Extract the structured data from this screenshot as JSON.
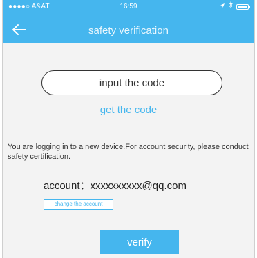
{
  "status_bar": {
    "carrier": "●●●●○ A&AT",
    "time": "16:59"
  },
  "header": {
    "title": "safety verification"
  },
  "form": {
    "code_placeholder": "input the code",
    "get_code_label": "get the code",
    "notice": "You are logging in to a new device.For account security, please conduct safety certification.",
    "account_text": "account：xxxxxxxxxx@qq.com",
    "change_account_label": "change the account",
    "verify_label": "verify"
  },
  "colors": {
    "accent": "#45b6ee",
    "background": "#f3f3f3"
  }
}
